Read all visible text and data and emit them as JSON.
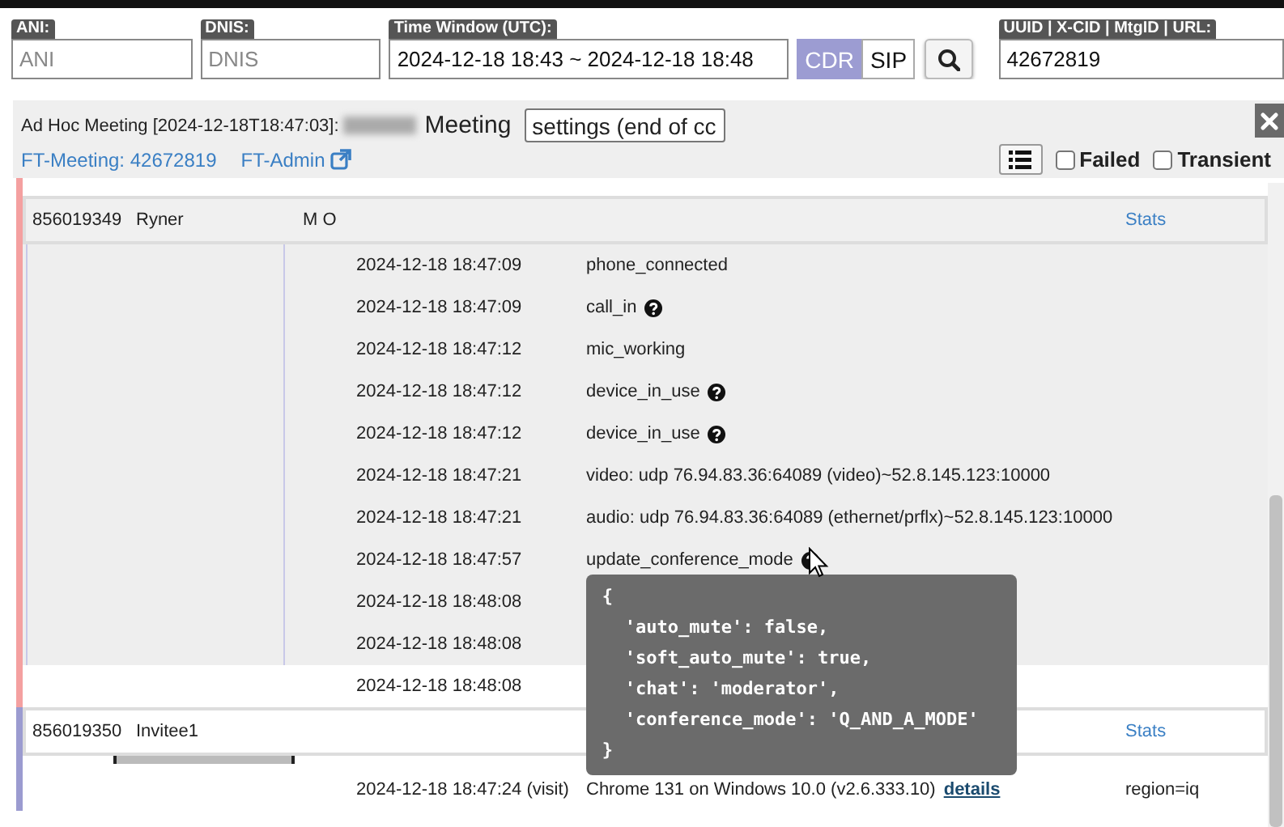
{
  "filters": [
    {
      "label": "ANI:",
      "placeholder": "ANI"
    },
    {
      "label": "DNIS:",
      "placeholder": "DNIS"
    },
    {
      "label": "Time Window (UTC):",
      "value": "2024-12-18 18:43 ~ 2024-12-18 18:48"
    }
  ],
  "mode_toggle": [
    {
      "label": "CDR",
      "selected": true
    },
    {
      "label": "SIP",
      "selected": false
    }
  ],
  "id_filter": {
    "label": "UUID | X-CID | MtgID | URL:",
    "value": "42672819"
  },
  "meeting": {
    "title": "Ad Hoc Meeting [2024-12-18T18:47:03]:",
    "name_suffix": "Meeting",
    "select_value": "settings (end of cc",
    "links": [
      {
        "label": "FT-Meeting: 42672819",
        "external": false
      },
      {
        "label": "FT-Admin",
        "external": true
      }
    ],
    "checkboxes": [
      {
        "label": "Failed",
        "checked": false
      },
      {
        "label": "Transient",
        "checked": false
      }
    ]
  },
  "participants": [
    {
      "id": "856019349",
      "name": "Ryner",
      "flags": "M O",
      "stats": "Stats",
      "color": "#f4a0a0",
      "bar": false,
      "events": [
        {
          "time": "2024-12-18 18:47:09",
          "event": "phone_connected",
          "help": false,
          "shaded": true
        },
        {
          "time": "2024-12-18 18:47:09",
          "event": "call_in",
          "help": true,
          "shaded": true
        },
        {
          "time": "2024-12-18 18:47:12",
          "event": "mic_working",
          "help": false,
          "shaded": true
        },
        {
          "time": "2024-12-18 18:47:12",
          "event": "device_in_use",
          "help": true,
          "shaded": true
        },
        {
          "time": "2024-12-18 18:47:12",
          "event": "device_in_use",
          "help": true,
          "shaded": true
        },
        {
          "time": "2024-12-18 18:47:21",
          "event": "video: udp 76.94.83.36:64089 (video)~52.8.145.123:10000",
          "help": false,
          "shaded": true
        },
        {
          "time": "2024-12-18 18:47:21",
          "event": "audio: udp 76.94.83.36:64089 (ethernet/prflx)~52.8.145.123:10000",
          "help": false,
          "shaded": true
        },
        {
          "time": "2024-12-18 18:47:57",
          "event": "update_conference_mode",
          "help": true,
          "shaded": true,
          "tooltip": [
            "{",
            "'auto_mute': false,",
            "'soft_auto_mute': true,",
            "'chat': 'moderator',",
            "'conference_mode': 'Q_AND_A_MODE'",
            "}"
          ]
        },
        {
          "time": "2024-12-18 18:48:08",
          "help": false,
          "shaded": true
        },
        {
          "time": "2024-12-18 18:48:08",
          "help": false,
          "shaded": true
        },
        {
          "time": "2024-12-18 18:48:08",
          "help": false,
          "shaded": false
        }
      ]
    },
    {
      "id": "856019350",
      "name": "Invitee1",
      "stats": "Stats",
      "color": "#9b9bd0",
      "bar": true,
      "events": [
        {
          "time": "2024-12-18 18:47:24 (visit)",
          "event": "Chrome 131 on Windows 10.0 (v2.6.333.10)",
          "link": "details",
          "extra": "region=iq",
          "help": false,
          "shaded": false
        }
      ]
    }
  ]
}
